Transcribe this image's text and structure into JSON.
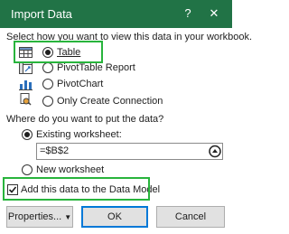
{
  "window": {
    "title": "Import Data",
    "help": "?",
    "close": "✕"
  },
  "view_section": {
    "prompt": "Select how you want to view this data in your workbook.",
    "options": [
      {
        "label": "Table",
        "selected": true,
        "icon": "table-icon"
      },
      {
        "label": "PivotTable Report",
        "selected": false,
        "icon": "pivottable-icon"
      },
      {
        "label": "PivotChart",
        "selected": false,
        "icon": "pivotchart-icon"
      },
      {
        "label": "Only Create Connection",
        "selected": false,
        "icon": "connection-icon"
      }
    ]
  },
  "location_section": {
    "prompt": "Where do you want to put the data?",
    "existing_label": "Existing worksheet:",
    "existing_selected": true,
    "range_value": "=$B$2",
    "new_label": "New worksheet",
    "new_selected": false
  },
  "data_model": {
    "label": "Add this data to the Data Model",
    "checked": true
  },
  "buttons": {
    "properties": "Properties...",
    "ok": "OK",
    "cancel": "Cancel"
  },
  "colors": {
    "titlebar": "#217346",
    "highlight": "#28b43c",
    "ok_border": "#0078d7"
  }
}
